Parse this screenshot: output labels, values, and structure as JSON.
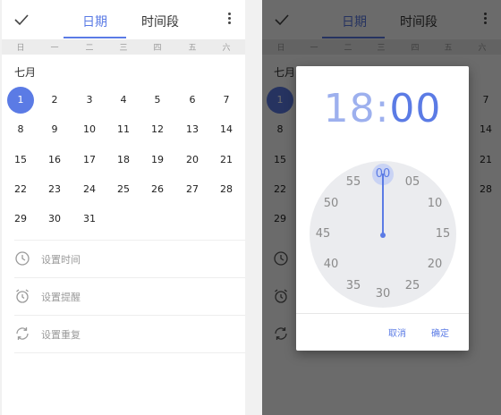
{
  "colors": {
    "accent": "#5b7be5",
    "accent_light": "#9db0ee",
    "dial_bg": "#ebecef"
  },
  "header": {
    "tab_date": "日期",
    "tab_range": "时间段",
    "icons": [
      "check-icon",
      "more-vert-icon"
    ]
  },
  "weekdays": [
    "日",
    "一",
    "二",
    "三",
    "四",
    "五",
    "六"
  ],
  "calendar": {
    "month_label": "七月",
    "selected_day": "1",
    "weeks": [
      [
        "1",
        "2",
        "3",
        "4",
        "5",
        "6",
        "7"
      ],
      [
        "8",
        "9",
        "10",
        "11",
        "12",
        "13",
        "14"
      ],
      [
        "15",
        "16",
        "17",
        "18",
        "19",
        "20",
        "21"
      ],
      [
        "22",
        "23",
        "24",
        "25",
        "26",
        "27",
        "28"
      ],
      [
        "29",
        "30",
        "31"
      ]
    ]
  },
  "options": [
    {
      "label": "设置时间",
      "icon": "clock-icon"
    },
    {
      "label": "设置提醒",
      "icon": "alarm-icon"
    },
    {
      "label": "设置重复",
      "icon": "repeat-icon"
    }
  ],
  "picker": {
    "hour": "18",
    "separator": ":",
    "minute": "00",
    "dial_labels": [
      "00",
      "05",
      "10",
      "15",
      "20",
      "25",
      "30",
      "35",
      "40",
      "45",
      "50",
      "55"
    ],
    "selected_label": "00",
    "cancel": "取消",
    "confirm": "确定"
  }
}
